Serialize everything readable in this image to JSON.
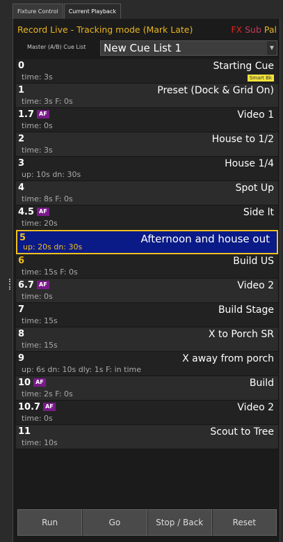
{
  "tabs": [
    {
      "label": "Fixture Control"
    },
    {
      "label": "Current Playback"
    }
  ],
  "status": {
    "mode_text": "Record Live - Tracking mode (Mark Late)",
    "flag_fx": "FX",
    "flag_sub": "Sub",
    "flag_pal": "Pal"
  },
  "cuelist": {
    "label": "Master (A/B) Cue List",
    "value": "New Cue List 1"
  },
  "cues": [
    {
      "num": "0",
      "af": false,
      "name": "Starting Cue",
      "time": "time: 3s",
      "badge": "Smart Bk"
    },
    {
      "num": "1",
      "af": false,
      "name": "Preset (Dock & Grid On)",
      "time": "time: 3s F: 0s"
    },
    {
      "num": "1.7",
      "af": true,
      "name": "Video 1",
      "time": "time: 0s"
    },
    {
      "num": "2",
      "af": false,
      "name": "House to 1/2",
      "time": "time: 3s"
    },
    {
      "num": "3",
      "af": false,
      "name": "House 1/4",
      "time": "up: 10s dn: 30s"
    },
    {
      "num": "4",
      "af": false,
      "name": "Spot Up",
      "time": "time: 8s F: 0s"
    },
    {
      "num": "4.5",
      "af": true,
      "name": "Side lt",
      "time": "time: 20s"
    },
    {
      "num": "5",
      "af": false,
      "name": "Afternoon and house out",
      "time": "up: 20s dn: 30s",
      "state": "current"
    },
    {
      "num": "6",
      "af": false,
      "name": "Build US",
      "time": "time: 15s F: 0s",
      "state": "next"
    },
    {
      "num": "6.7",
      "af": true,
      "name": "Video 2",
      "time": "time: 0s"
    },
    {
      "num": "7",
      "af": false,
      "name": "Build Stage",
      "time": "time: 15s"
    },
    {
      "num": "8",
      "af": false,
      "name": "X to Porch SR",
      "time": "time: 15s"
    },
    {
      "num": "9",
      "af": false,
      "name": "X away from porch",
      "time": "up: 6s dn: 10s dly: 1s F: in time"
    },
    {
      "num": "10",
      "af": true,
      "name": "Build",
      "time": "time: 2s F: 0s"
    },
    {
      "num": "10.7",
      "af": true,
      "name": "Video 2",
      "time": "time: 0s"
    },
    {
      "num": "11",
      "af": false,
      "name": "Scout to Tree",
      "time": "time: 10s"
    }
  ],
  "af_label": "AF",
  "buttons": [
    {
      "label": "Run"
    },
    {
      "label": "Go"
    },
    {
      "label": "Stop / Back"
    },
    {
      "label": "Reset"
    }
  ],
  "colors": {
    "status_yellow": "#e8b520",
    "fx_red": "#e8231f",
    "current_bg": "#0a1a86",
    "af_purple": "#7a1a8a"
  }
}
